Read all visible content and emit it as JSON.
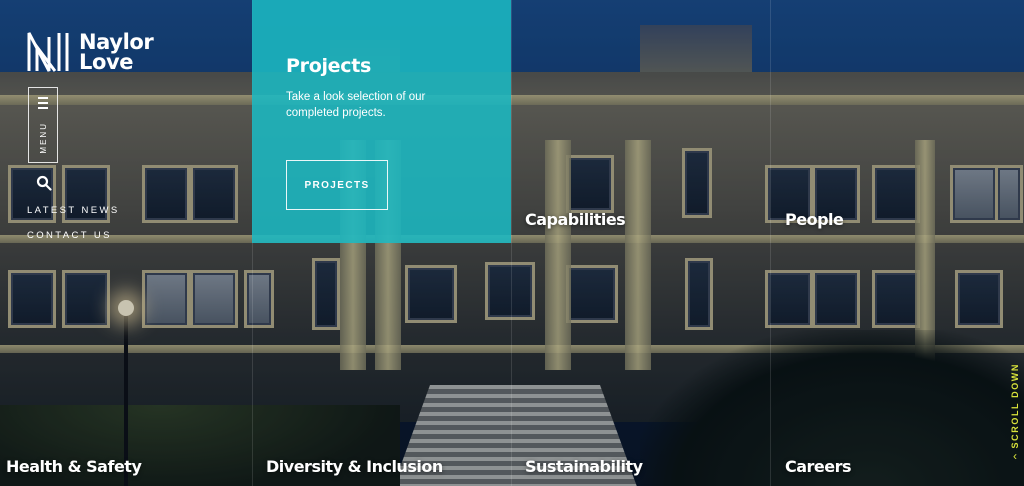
{
  "brand": {
    "logo_icon": "naylor-love-mark-icon",
    "name_line1": "Naylor",
    "name_line2": "Love"
  },
  "nav": {
    "menu_label": "MENU",
    "menu_icon": "hamburger-icon",
    "search_icon": "search-icon",
    "links": [
      "LATEST NEWS",
      "CONTACT US"
    ]
  },
  "projects": {
    "title": "Projects",
    "description": "Take a look selection of our completed projects.",
    "button_label": "PROJECTS",
    "panel_color": "#1bb8c2"
  },
  "tiles": {
    "capabilities": "Capabilities",
    "people": "People",
    "health_safety": "Health & Safety",
    "diversity": "Diversity & Inclusion",
    "sustainability": "Sustainability",
    "careers": "Careers"
  },
  "scroll": {
    "label": "SCROLL DOWN",
    "arrow_icon": "chevron-down-icon",
    "color": "#d8e23a"
  }
}
